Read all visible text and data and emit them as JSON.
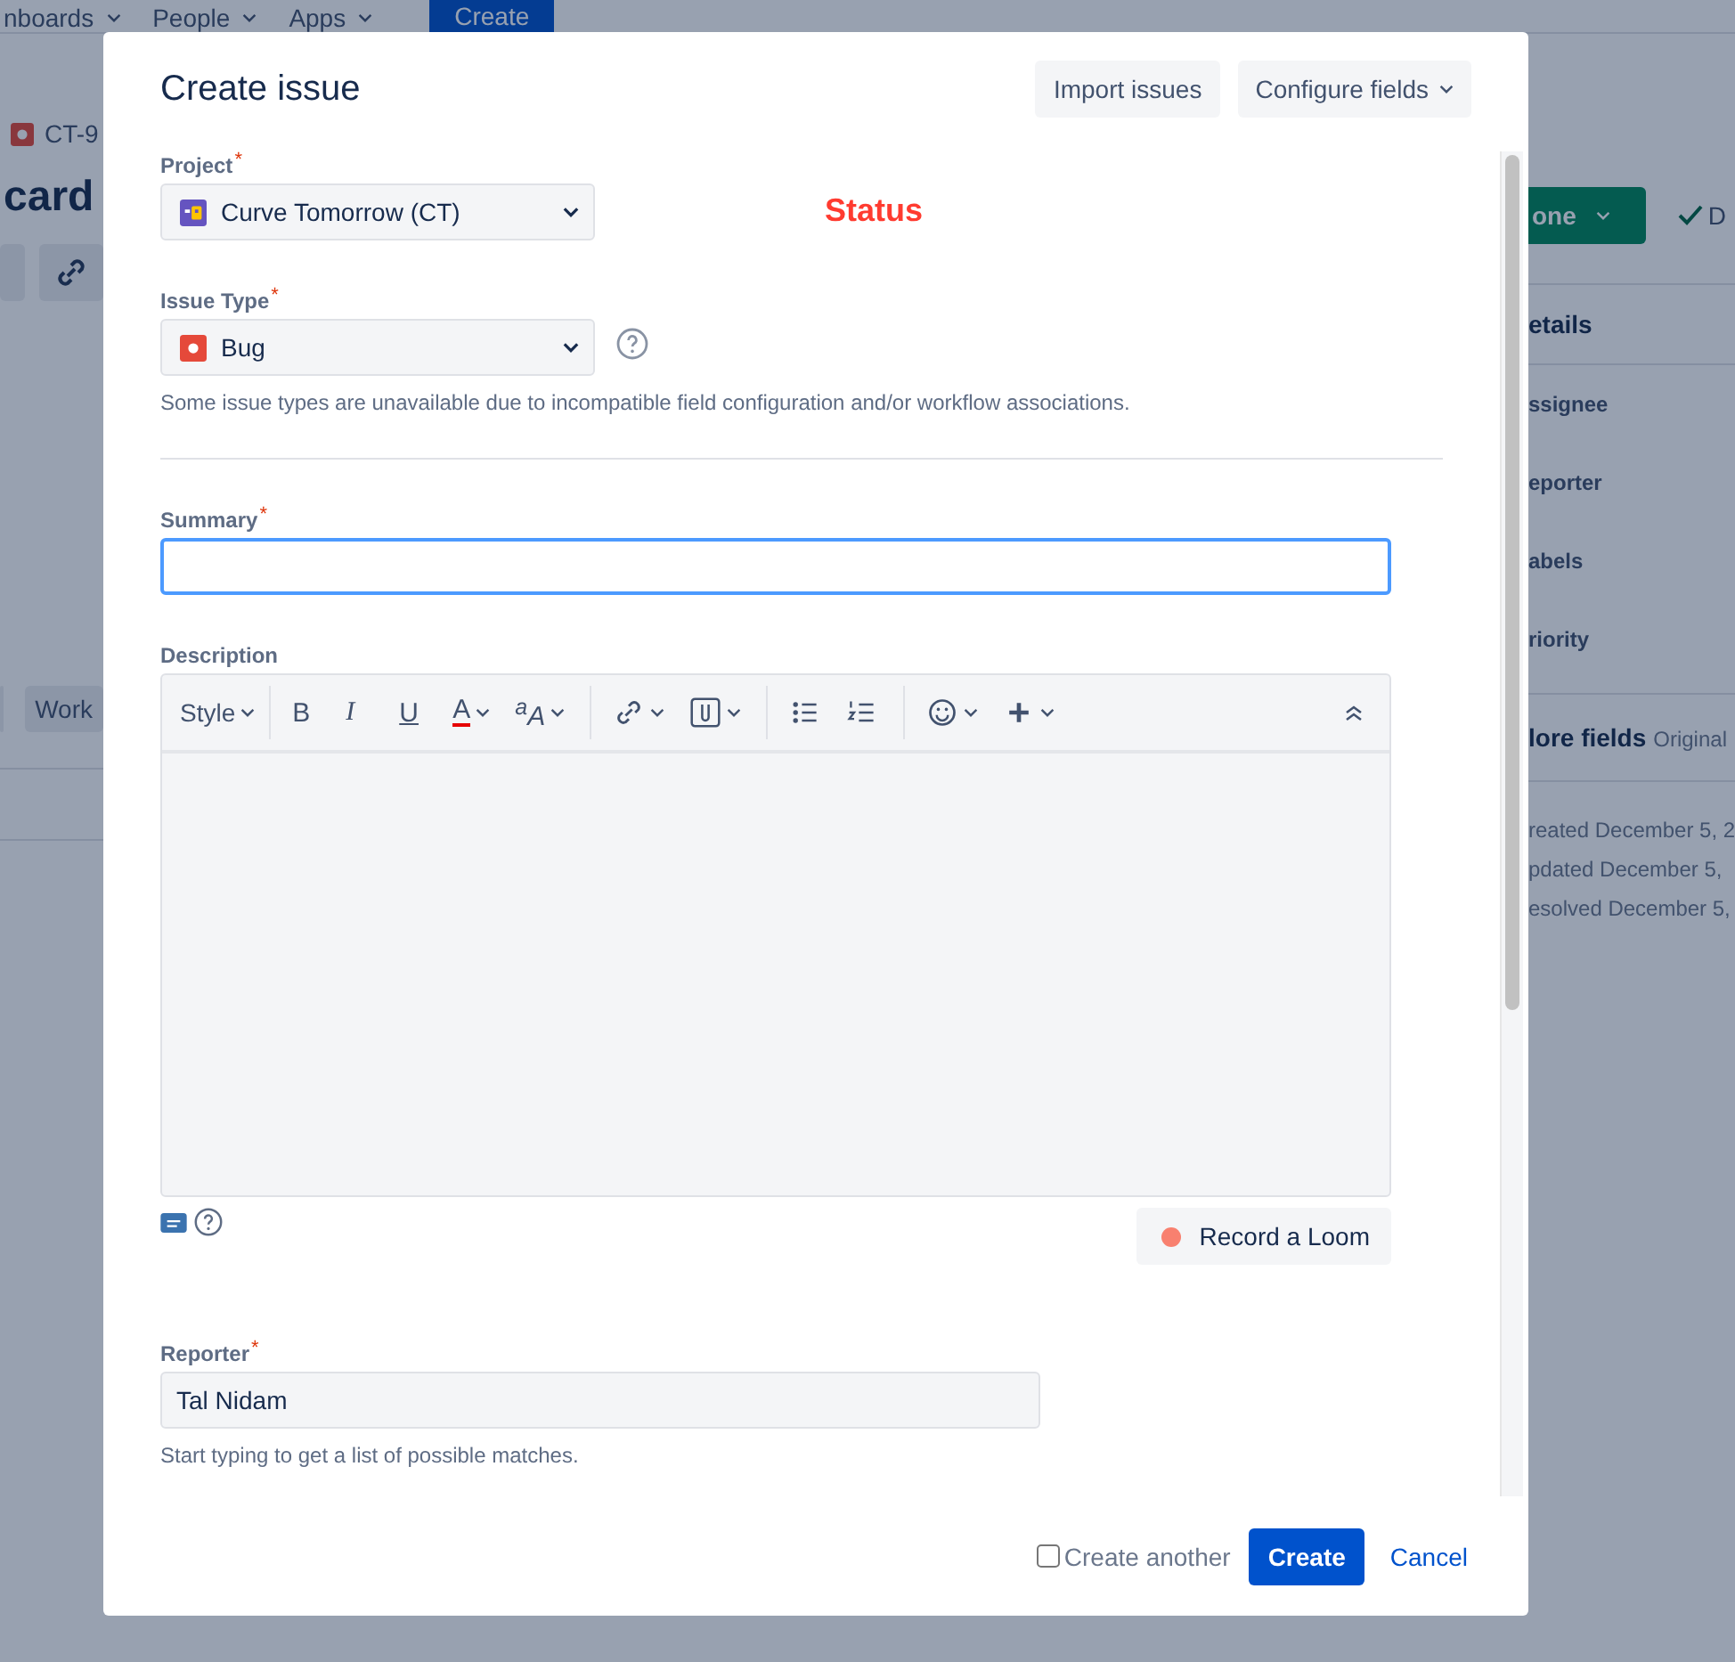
{
  "background": {
    "nav": [
      "nboards",
      "People",
      "Apps"
    ],
    "create_button": "Create",
    "issue_key": "CT-9",
    "title": "card",
    "tab": "Work",
    "status_button": "one",
    "resolution": "D",
    "details_heading": "etails",
    "detail_fields": [
      "ssignee",
      "eporter",
      "abels",
      "riority"
    ],
    "more_fields": "lore fields",
    "more_fields_hint": "Original",
    "dates": [
      "reated December 5, 2",
      "pdated December 5,",
      "esolved December 5,"
    ]
  },
  "dialog": {
    "title": "Create issue",
    "header_buttons": [
      {
        "label": "Import issues",
        "dropdown": false
      },
      {
        "label": "Configure fields",
        "dropdown": true
      }
    ],
    "project": {
      "label": "Project",
      "required_mark": "*",
      "value": "Curve Tomorrow (CT)"
    },
    "status_note": "Status",
    "issue_type": {
      "label": "Issue Type",
      "required_mark": "*",
      "value": "Bug",
      "hint": "Some issue types are unavailable due to incompatible field configuration and/or workflow associations."
    },
    "summary": {
      "label": "Summary",
      "required_mark": "*",
      "focused": true
    },
    "description": {
      "label": "Description",
      "style_menu": "Style",
      "format_buttons": [
        {
          "label": "B",
          "kind": "bold"
        },
        {
          "label": "I",
          "kind": "italic"
        },
        {
          "label": "U",
          "kind": "underline"
        },
        {
          "label": "A",
          "kind": "color"
        },
        {
          "label": "$^{a}$A",
          "kind": "clear"
        }
      ],
      "loom_button": "Record a Loom"
    },
    "reporter": {
      "label": "Reporter",
      "required_mark": "*",
      "value": "Tal Nidam",
      "hint": "Start typing to get a list of possible matches."
    },
    "create_another": {
      "label": "Create another",
      "checked": false
    },
    "submit": "Create",
    "cancel": "Cancel"
  }
}
